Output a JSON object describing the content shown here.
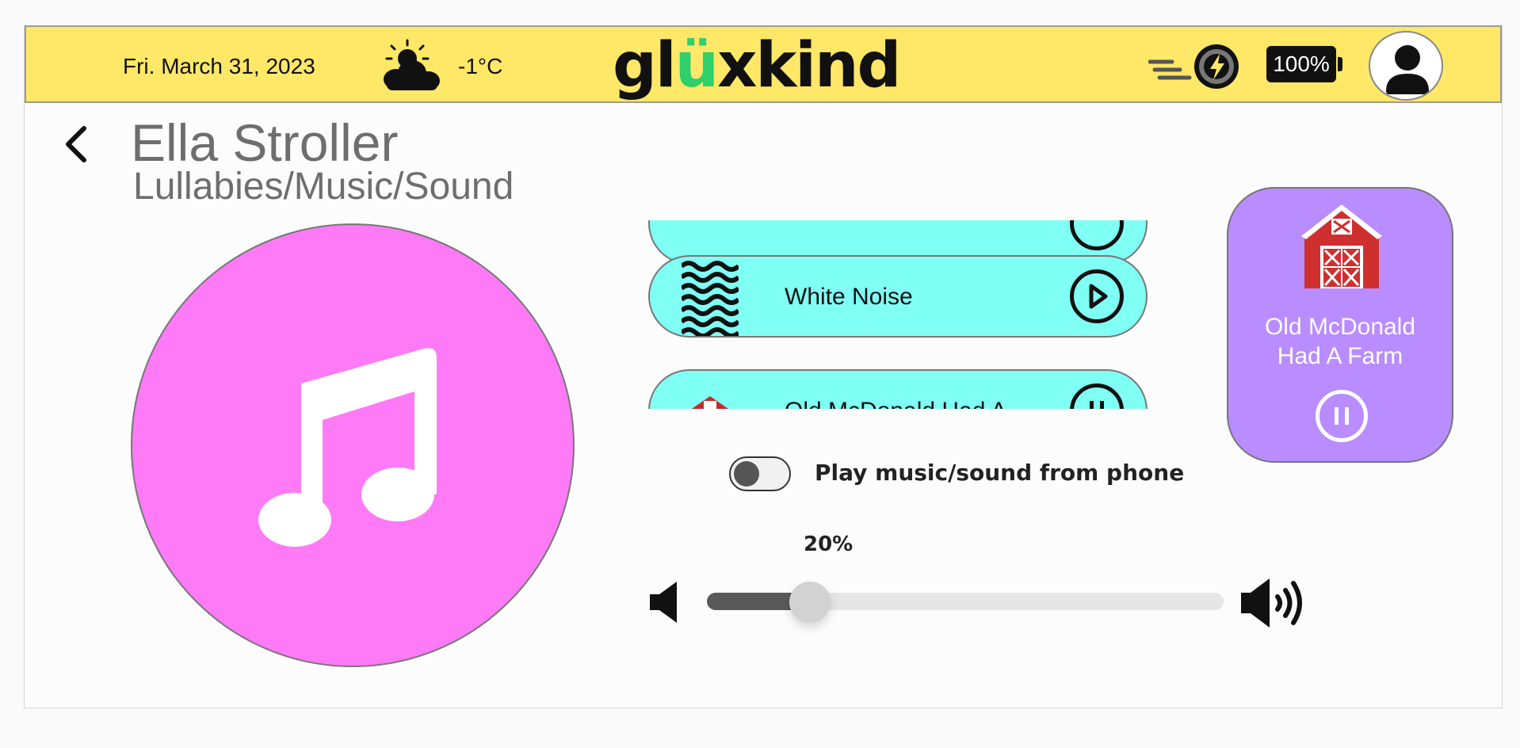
{
  "header": {
    "date": "Fri. March 31, 2023",
    "weather_icon": "partly-cloudy-sun-icon",
    "temperature": "-1°C",
    "brand": {
      "left": "gl",
      "mid": "ü",
      "right": "xkind"
    },
    "brake_icon": "brake-lightning-icon",
    "battery": "100%",
    "profile_icon": "user-icon"
  },
  "page": {
    "title": "Ella Stroller",
    "subtitle": "Lullabies/Music/Sound",
    "back_icon": "chevron-left-icon"
  },
  "hero": {
    "icon": "music-note-icon",
    "color": "#ff7af6"
  },
  "playlist": {
    "items": [
      {
        "label": "",
        "thumb": "none",
        "state": "play"
      },
      {
        "label": "White Noise",
        "thumb": "waves-icon",
        "state": "play"
      },
      {
        "label": "Old McDonald Had A",
        "thumb": "barn-icon",
        "state": "pause"
      }
    ],
    "card_color": "#80fff5"
  },
  "now_playing": {
    "title_line1": "Old McDonald",
    "title_line2": "Had A Farm",
    "icon": "barn-icon",
    "control": "pause",
    "color": "#b98cff"
  },
  "phone_toggle": {
    "label": "Play music/sound from phone",
    "on": false
  },
  "volume": {
    "percent_label": "20%",
    "level": 0.2
  }
}
